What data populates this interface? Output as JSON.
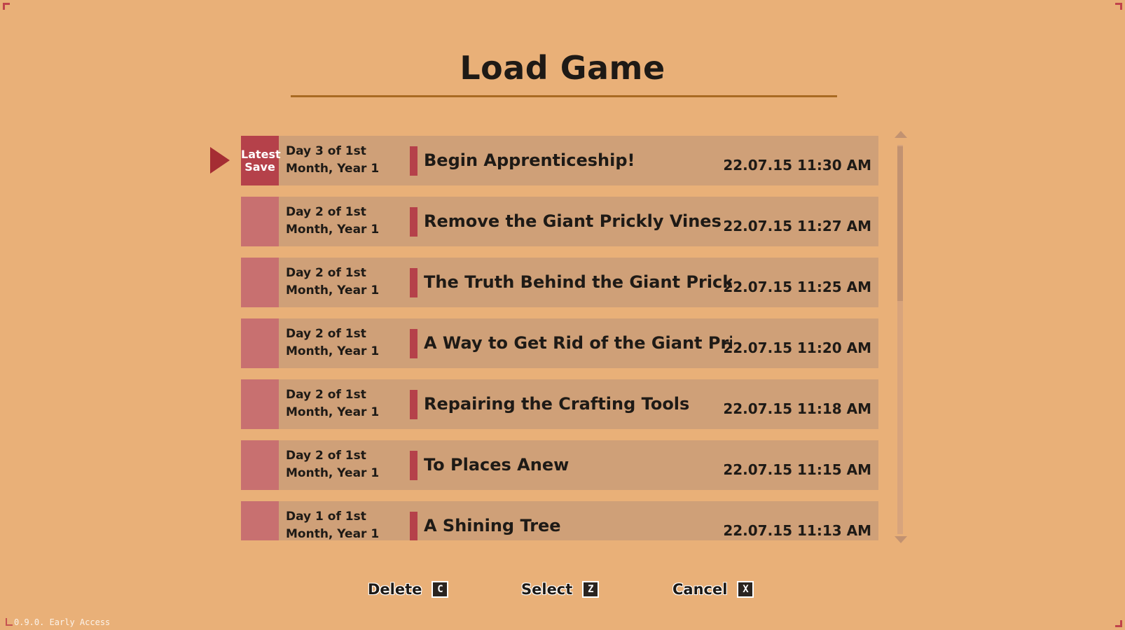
{
  "title": "Load Game",
  "latest_badge": [
    "Latest",
    "Save"
  ],
  "saves": [
    {
      "day": "Day 3 of 1st Month, Year 1",
      "quest": "Begin Apprenticeship!",
      "timestamp": "22.07.15 11:30 AM",
      "latest": true
    },
    {
      "day": "Day 2 of 1st Month, Year 1",
      "quest": "Remove the Giant Prickly Vines",
      "timestamp": "22.07.15 11:27 AM",
      "latest": false
    },
    {
      "day": "Day 2 of 1st Month, Year 1",
      "quest": "The Truth Behind the Giant Prickly Vines",
      "timestamp": "22.07.15 11:25 AM",
      "latest": false
    },
    {
      "day": "Day 2 of 1st Month, Year 1",
      "quest": "A Way to Get Rid of the Giant Prickly …",
      "timestamp": "22.07.15 11:20 AM",
      "latest": false
    },
    {
      "day": "Day 2 of 1st Month, Year 1",
      "quest": "Repairing the Crafting Tools",
      "timestamp": "22.07.15 11:18 AM",
      "latest": false
    },
    {
      "day": "Day 2 of 1st Month, Year 1",
      "quest": "To Places Anew",
      "timestamp": "22.07.15 11:15 AM",
      "latest": false
    },
    {
      "day": "Day 1 of 1st Month, Year 1",
      "quest": "A Shining Tree",
      "timestamp": "22.07.15 11:13 AM",
      "latest": false
    }
  ],
  "selected_index": 0,
  "actions": {
    "delete": {
      "label": "Delete",
      "key": "C"
    },
    "select": {
      "label": "Select",
      "key": "Z"
    },
    "cancel": {
      "label": "Cancel",
      "key": "X"
    }
  },
  "version": "0.9.0. Early Access",
  "colors": {
    "background": "#e9b078",
    "row": "#cfa078",
    "badge": "#c87070",
    "badge_latest": "#b5414a",
    "accent": "#b5414a"
  }
}
